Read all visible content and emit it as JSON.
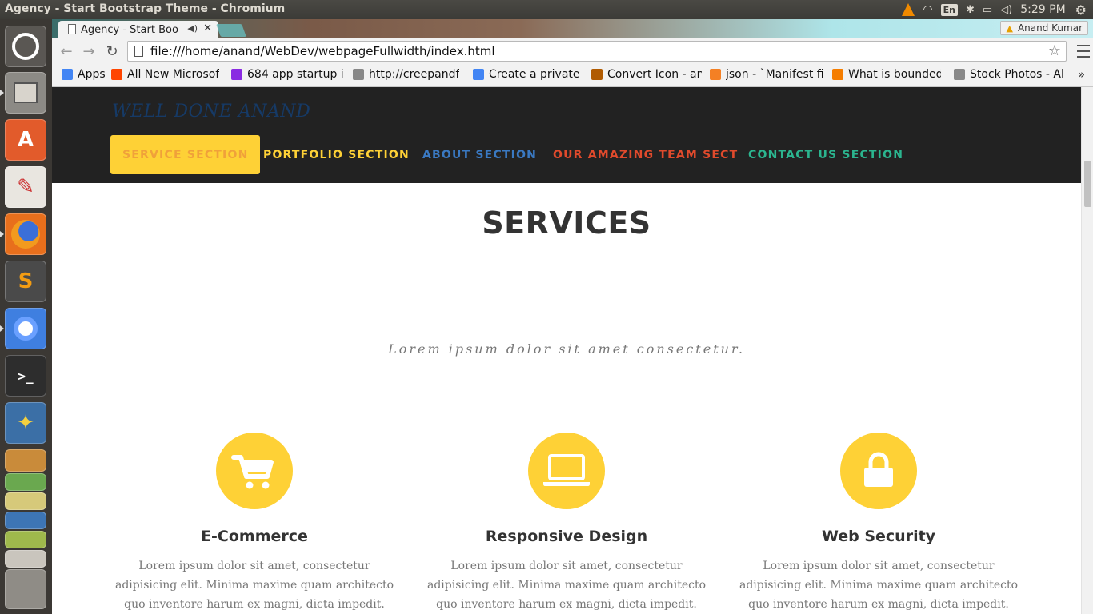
{
  "os": {
    "window_title": "Agency - Start Bootstrap Theme - Chromium",
    "keyboard_layout": "En",
    "clock": "5:29 PM",
    "launcher_apps": [
      "ubuntu-dash",
      "files",
      "software-center",
      "document-viewer",
      "firefox",
      "sublime-text",
      "chromium",
      "terminal",
      "python",
      "vlc",
      "workspace-switcher",
      "text-editor",
      "calc",
      "impress",
      "writer",
      "trash"
    ]
  },
  "browser": {
    "tab_title": "Agency - Start Boo",
    "user_name": "Anand Kumar",
    "url": "file:///home/anand/WebDev/webpageFullwidth/index.html",
    "bookmarks": [
      {
        "label": "Apps",
        "icon": "apps-grid-icon",
        "color": "#4285f4"
      },
      {
        "label": "All New Microsof",
        "icon": "reddit-icon",
        "color": "#ff4500"
      },
      {
        "label": "684 app startup i",
        "icon": "startup-icon",
        "color": "#8a2be2"
      },
      {
        "label": "http://creepandf",
        "icon": "page-icon",
        "color": "#888888"
      },
      {
        "label": "Create a private C",
        "icon": "google-icon",
        "color": "#4285f4"
      },
      {
        "label": "Convert Icon - an",
        "icon": "convert-icon",
        "color": "#b05a00"
      },
      {
        "label": "json - `Manifest fi",
        "icon": "stackoverflow-icon",
        "color": "#f48024"
      },
      {
        "label": "What is bounded",
        "icon": "blogger-icon",
        "color": "#f57d00"
      },
      {
        "label": "Stock Photos - Al",
        "icon": "page-icon",
        "color": "#888888"
      }
    ],
    "more_bookmarks": "»"
  },
  "site": {
    "brand": "WELL DONE ANAND",
    "nav": [
      {
        "label": "SERVICE SECTION",
        "color": "#f0a13a",
        "active": true
      },
      {
        "label": "PORTFOLIO SECTION",
        "color": "#fed136",
        "active": false
      },
      {
        "label": "ABOUT SECTION",
        "color": "#3a79c2",
        "active": false
      },
      {
        "label": "OUR AMAZING TEAM SECT",
        "color": "#e04a2c",
        "active": false
      },
      {
        "label": "CONTACT US SECTION",
        "color": "#2bb58f",
        "active": false
      }
    ],
    "services": {
      "title": "SERVICES",
      "subtitle": "Lorem ipsum dolor sit amet consectetur.",
      "items": [
        {
          "icon": "shopping-cart-icon",
          "heading": "E-Commerce",
          "text": "Lorem ipsum dolor sit amet, consectetur adipisicing elit. Minima maxime quam architecto quo inventore harum ex magni, dicta impedit."
        },
        {
          "icon": "laptop-icon",
          "heading": "Responsive Design",
          "text": "Lorem ipsum dolor sit amet, consectetur adipisicing elit. Minima maxime quam architecto quo inventore harum ex magni, dicta impedit."
        },
        {
          "icon": "lock-icon",
          "heading": "Web Security",
          "text": "Lorem ipsum dolor sit amet, consectetur adipisicing elit. Minima maxime quam architecto quo inventore harum ex magni, dicta impedit."
        }
      ]
    },
    "accent_color": "#fed136"
  }
}
